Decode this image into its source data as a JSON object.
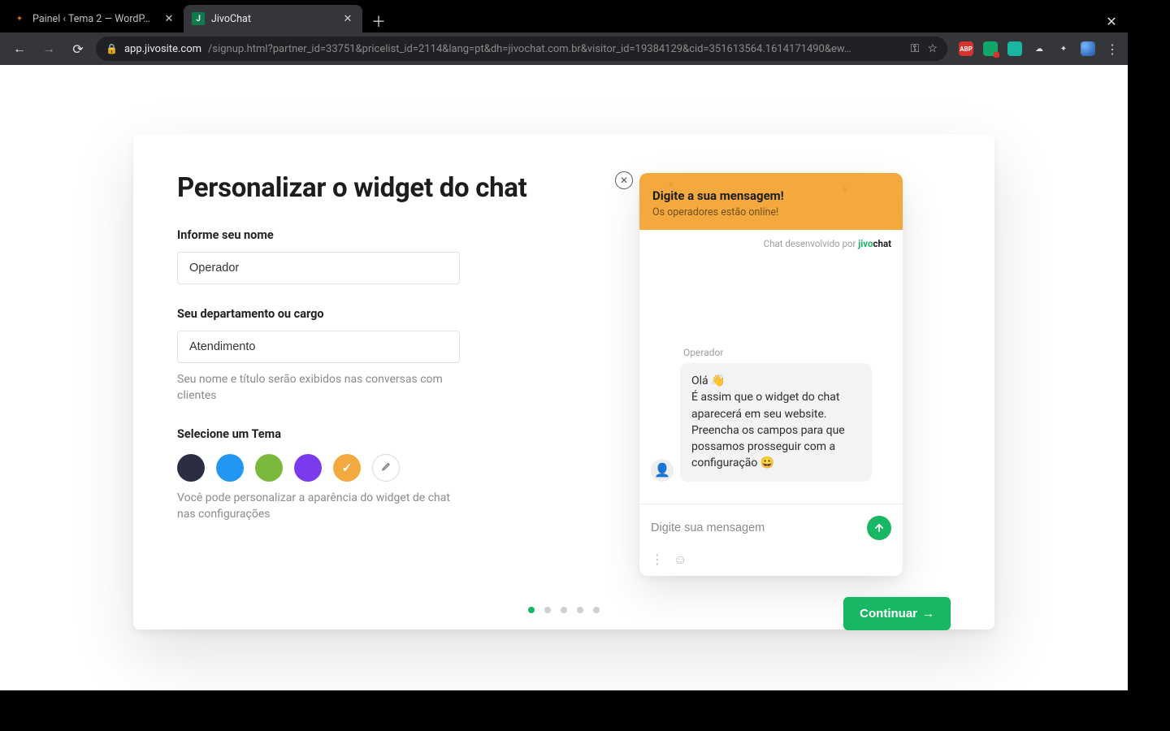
{
  "browser": {
    "tabs": [
      {
        "title": "Painel ‹ Tema 2 — WordP…",
        "active": false
      },
      {
        "title": "JivoChat",
        "active": true
      }
    ],
    "url_host": "app.jivosite.com",
    "url_rest": "/signup.html?partner_id=33751&pricelist_id=2114&lang=pt&dh=jivochat.com.br&visitor_id=19384129&cid=351613564.1614171490&ew…"
  },
  "page": {
    "title": "Personalizar o widget do chat",
    "name_label": "Informe seu nome",
    "name_value": "Operador",
    "dept_label": "Seu departamento ou cargo",
    "dept_value": "Atendimento",
    "dept_hint": "Seu nome e título serão exibidos nas conversas com clientes",
    "theme_label": "Selecione um Tema",
    "theme_hint": "Você pode personalizar a aparência do widget de chat nas configurações",
    "themes": [
      {
        "color": "#2b2d42",
        "selected": false
      },
      {
        "color": "#2196f3",
        "selected": false
      },
      {
        "color": "#7bb93e",
        "selected": false
      },
      {
        "color": "#7c3aed",
        "selected": false
      },
      {
        "color": "#f4a93f",
        "selected": true
      }
    ],
    "continue_label": "Continuar",
    "dots_total": 5,
    "dots_active_index": 0
  },
  "chat": {
    "header_bg": "#f4a93f",
    "header_title": "Digite a sua mensagem!",
    "header_sub": "Os operadores estão online!",
    "powered_prefix": "Chat desenvolvido por ",
    "powered_brand_pre": "jivo",
    "powered_brand_post": "chat",
    "operator_name": "Operador",
    "message": "Olá 👋\nÉ assim que o widget do chat aparecerá em seu website. Preencha os campos para que possamos prosseguir com a configuração 😀",
    "input_placeholder": "Digite sua mensagem"
  }
}
